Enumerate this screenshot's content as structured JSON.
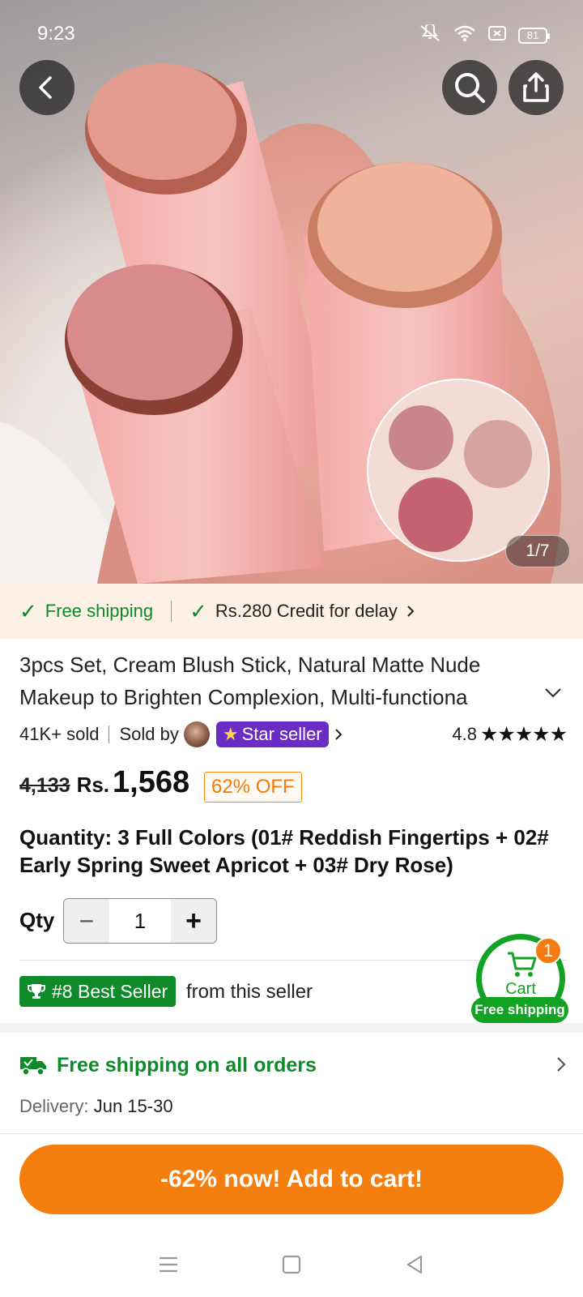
{
  "status_bar": {
    "time": "9:23",
    "battery": "81"
  },
  "hero": {
    "image_counter": "1/7"
  },
  "shipping_banner": {
    "free_shipping": "Free shipping",
    "credit": "Rs.280 Credit for delay"
  },
  "product": {
    "title": "3pcs Set, Cream Blush Stick, Natural Matte Nude Makeup to Brighten Complexion, Multi-functiona",
    "sold": "41K+ sold",
    "sold_by": "Sold by",
    "seller_badge": "Star seller",
    "rating": "4.8",
    "stars": "★★★★★",
    "old_price": "4,133",
    "currency": "Rs.",
    "price": "1,568",
    "discount": "62% OFF",
    "variant": "Quantity: 3 Full Colors (01# Reddish Fingertips + 02# Early Spring Sweet Apricot + 03# Dry Rose)"
  },
  "quantity": {
    "label": "Qty",
    "value": "1",
    "minus": "−",
    "plus": "+"
  },
  "best_seller": {
    "badge": "#8 Best Seller",
    "tail": "from this seller"
  },
  "cart": {
    "label": "Cart",
    "count": "1",
    "shipping_tag": "Free shipping"
  },
  "shipping_section": {
    "title": "Free shipping on all orders",
    "delivery_label": "Delivery:",
    "delivery_value": "Jun 15-30"
  },
  "cta": {
    "add_to_cart": "-62% now! Add to cart!"
  },
  "colors": {
    "accent": "#f57f0e",
    "green": "#0e8a2b",
    "cart_green": "#12a323",
    "star_seller": "#6a2cc4"
  }
}
